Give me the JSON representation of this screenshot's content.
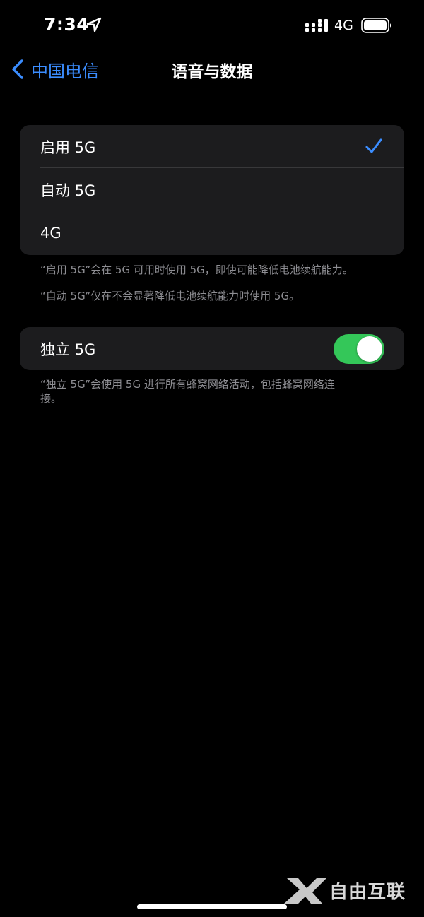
{
  "status_bar": {
    "time": "7:34",
    "network_type": "4G",
    "icons": [
      "location-arrow-icon",
      "signal-bars-icon",
      "battery-icon"
    ]
  },
  "nav": {
    "back_label": "中国电信",
    "title": "语音与数据"
  },
  "options": [
    {
      "label": "启用 5G",
      "selected": true
    },
    {
      "label": "自动 5G",
      "selected": false
    },
    {
      "label": "4G",
      "selected": false
    }
  ],
  "footnotes": {
    "enable_5g": "“启用 5G”会在 5G 可用时使用 5G，即使可能降低电池续航能力。",
    "auto_5g": "“自动 5G”仅在不会显著降低电池续航能力时使用 5G。",
    "standalone_5g": "“独立 5G”会使用 5G 进行所有蜂窝网络活动，包括蜂窝网络连接。"
  },
  "standalone": {
    "label": "独立 5G",
    "enabled": true
  },
  "watermark": {
    "text": "自由互联"
  },
  "colors": {
    "accent": "#3b8dff",
    "toggle_on": "#34c759",
    "card_bg": "#1c1c1e",
    "footnote": "#8e8e93"
  }
}
